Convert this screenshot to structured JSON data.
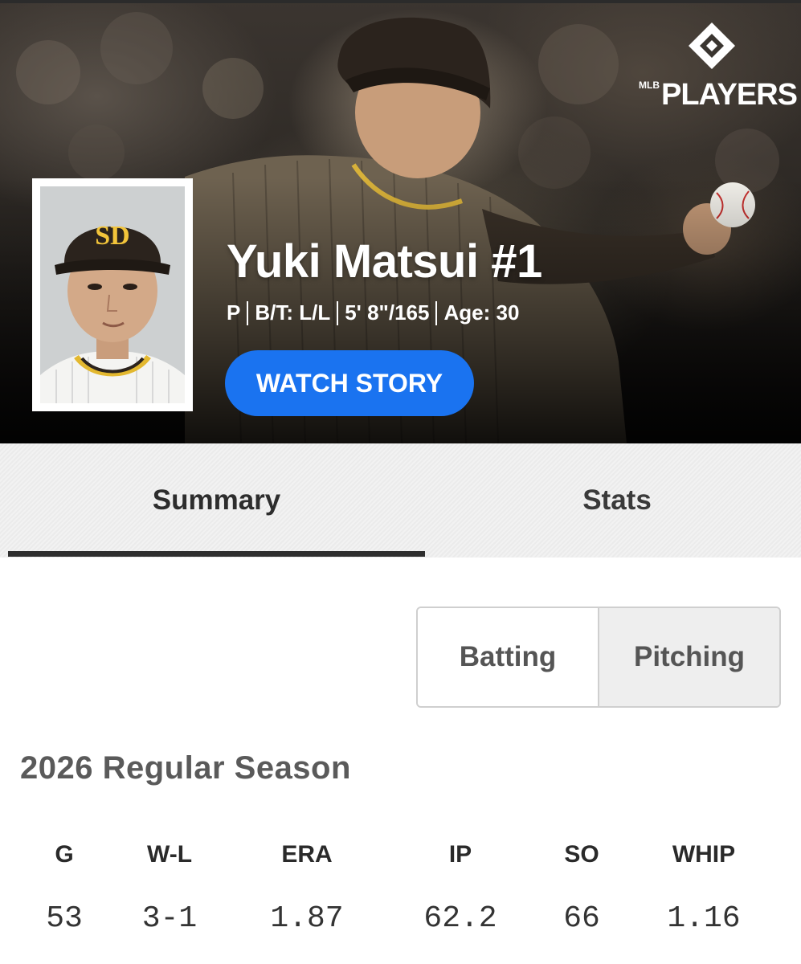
{
  "brand": {
    "logo_main": "PLAYERS",
    "logo_prefix": "MLB",
    "logo_icon": "diamond-logo-icon"
  },
  "player": {
    "name": "Yuki Matsui #1",
    "position": "P",
    "bats_throws": "B/T: L/L",
    "height_weight": "5' 8\"/165",
    "age": "Age: 30",
    "team_cap_logo": "SD"
  },
  "hero": {
    "watch_button": "WATCH STORY"
  },
  "tabs": [
    {
      "label": "Summary",
      "active": true
    },
    {
      "label": "Stats",
      "active": false
    }
  ],
  "toggle": {
    "batting": "Batting",
    "pitching": "Pitching",
    "selected": "Pitching"
  },
  "season": {
    "title": "2026 Regular Season",
    "stats": [
      {
        "label": "G",
        "value": "53"
      },
      {
        "label": "W-L",
        "value": "3-1"
      },
      {
        "label": "ERA",
        "value": "1.87"
      },
      {
        "label": "IP",
        "value": "62.2"
      },
      {
        "label": "SO",
        "value": "66"
      },
      {
        "label": "WHIP",
        "value": "1.16"
      }
    ]
  },
  "colors": {
    "accent_blue": "#1a73f0",
    "tab_indicator": "#2f2f2f",
    "team_brown": "#2f241d",
    "team_gold": "#ffc425"
  }
}
